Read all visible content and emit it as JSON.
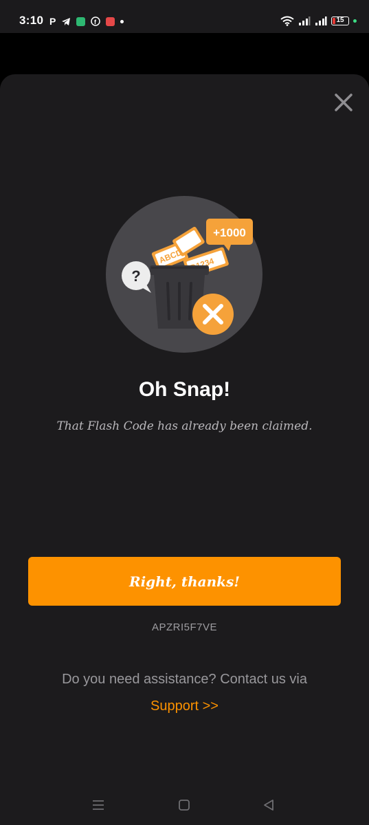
{
  "status_bar": {
    "time": "3:10",
    "battery_level": "15",
    "icons": [
      "p-icon",
      "telegram-icon",
      "app-icon",
      "facebook-icon",
      "sos-icon",
      "dot-icon",
      "wifi-icon",
      "signal-icon",
      "signal-icon-2",
      "battery-icon",
      "green-dot-icon"
    ]
  },
  "illustration": {
    "badge_text": "+1000",
    "ticket_text_1": "ABCD",
    "ticket_text_2": "D1234",
    "question_mark": "?"
  },
  "dialog": {
    "title": "Oh Snap!",
    "message": "That Flash Code has already been claimed.",
    "button_label": "Right, thanks!",
    "code": "APZRI5F7VE",
    "assist_text": "Do you need assistance? Contact us via",
    "support_link": "Support >>"
  },
  "colors": {
    "accent": "#fd9200",
    "sheet_background": "#1c1b1d",
    "circle_background": "#48474b"
  }
}
